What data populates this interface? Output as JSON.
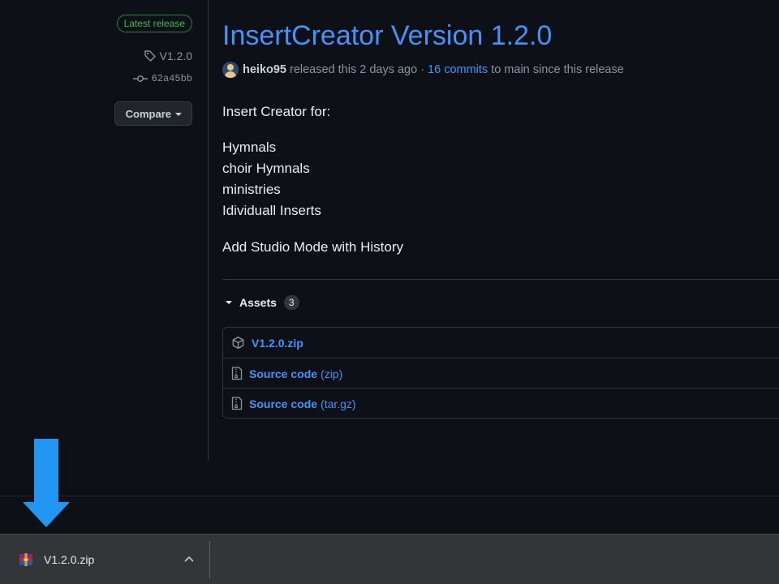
{
  "sidebar": {
    "latest_badge": "Latest release",
    "tag": "V1.2.0",
    "commit": "62a45bb",
    "compare_label": "Compare"
  },
  "release": {
    "title": "InsertCreator Version 1.2.0",
    "author": "heiko95",
    "released_text": "released this 2 days ago ·",
    "commits_link": "16 commits",
    "commits_suffix": "to main since this release",
    "body": {
      "intro": "Insert Creator for:",
      "list": [
        "Hymnals",
        "choir Hymnals",
        "ministries",
        "Idividuall Inserts"
      ],
      "note": "Add Studio Mode with History"
    }
  },
  "assets": {
    "label": "Assets",
    "count": "3",
    "items": [
      {
        "name": "V1.2.0.zip",
        "sub": "",
        "icon": "package-icon"
      },
      {
        "name": "Source code",
        "sub": "(zip)",
        "icon": "file-zip-icon"
      },
      {
        "name": "Source code",
        "sub": "(tar.gz)",
        "icon": "file-zip-icon"
      }
    ]
  },
  "download_bar": {
    "file_name": "V1.2.0.zip",
    "icon": "winrar-archive-icon"
  },
  "colors": {
    "accent_link": "#4493f8",
    "background": "#0d1117",
    "badge_green": "#3fb950",
    "annotation_arrow": "#2196f3"
  }
}
